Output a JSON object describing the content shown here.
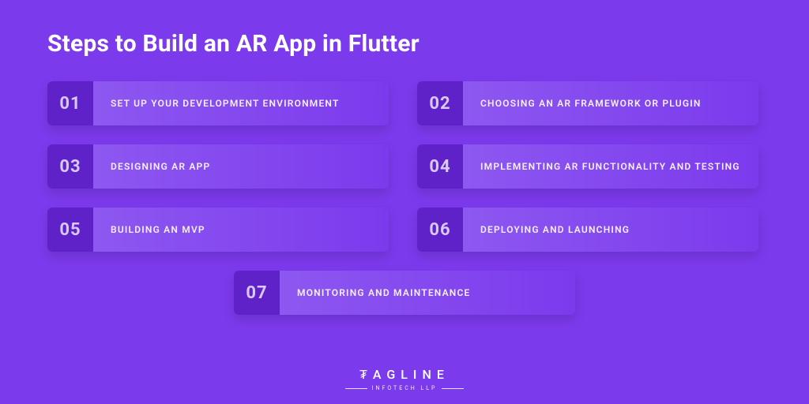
{
  "title": "Steps to Build an AR App in Flutter",
  "steps": [
    {
      "num": "01",
      "label": "SET UP YOUR DEVELOPMENT ENVIRONMENT"
    },
    {
      "num": "02",
      "label": "CHOOSING AN AR FRAMEWORK OR PLUGIN"
    },
    {
      "num": "03",
      "label": "DESIGNING AR APP"
    },
    {
      "num": "04",
      "label": "IMPLEMENTING AR FUNCTIONALITY AND TESTING"
    },
    {
      "num": "05",
      "label": "BUILDING AN MVP"
    },
    {
      "num": "06",
      "label": "DEPLOYING AND LAUNCHING"
    },
    {
      "num": "07",
      "label": "MONITORING AND MAINTENANCE"
    }
  ],
  "footer": {
    "brand": "₮AGLINE",
    "sub": "INFOTECH LLP"
  }
}
